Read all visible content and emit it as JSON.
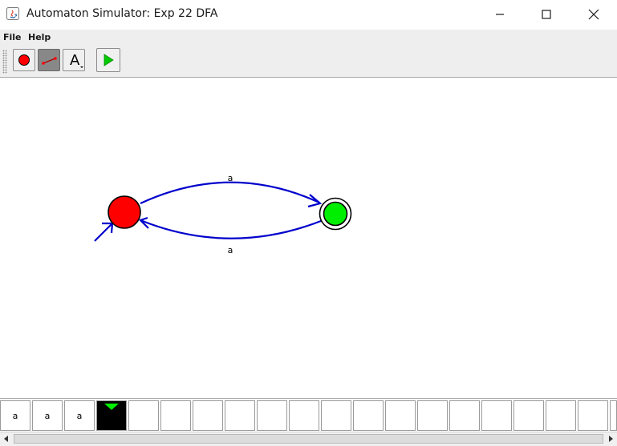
{
  "window": {
    "title": "Automaton Simulator: Exp 22 DFA",
    "controls": [
      "minimize",
      "maximize",
      "close"
    ]
  },
  "menu": {
    "items": [
      {
        "label": "File"
      },
      {
        "label": "Help"
      }
    ]
  },
  "toolbar": {
    "tools": [
      {
        "icon": "state-tool-icon",
        "selected": false
      },
      {
        "icon": "transition-tool-icon",
        "selected": true
      },
      {
        "icon": "text-tool-icon",
        "label": "A",
        "selected": false
      },
      {
        "icon": "run-icon",
        "selected": false
      }
    ]
  },
  "automaton": {
    "states": [
      {
        "id": "q0",
        "color": "#ff0000",
        "start": true,
        "accepting": false
      },
      {
        "id": "q1",
        "color": "#00ff00",
        "start": false,
        "accepting": true
      }
    ],
    "transitions": [
      {
        "from": "q0",
        "to": "q1",
        "label": "a"
      },
      {
        "from": "q1",
        "to": "q0",
        "label": "a"
      }
    ],
    "edge_color": "#0000cc"
  },
  "tape": {
    "cells": [
      "a",
      "a",
      "a",
      "",
      "",
      "",
      "",
      "",
      "",
      "",
      "",
      "",
      "",
      "",
      "",
      "",
      "",
      "",
      "",
      ""
    ],
    "head_index": 3,
    "head_color": "#000000",
    "head_marker_color": "#00ff00"
  }
}
